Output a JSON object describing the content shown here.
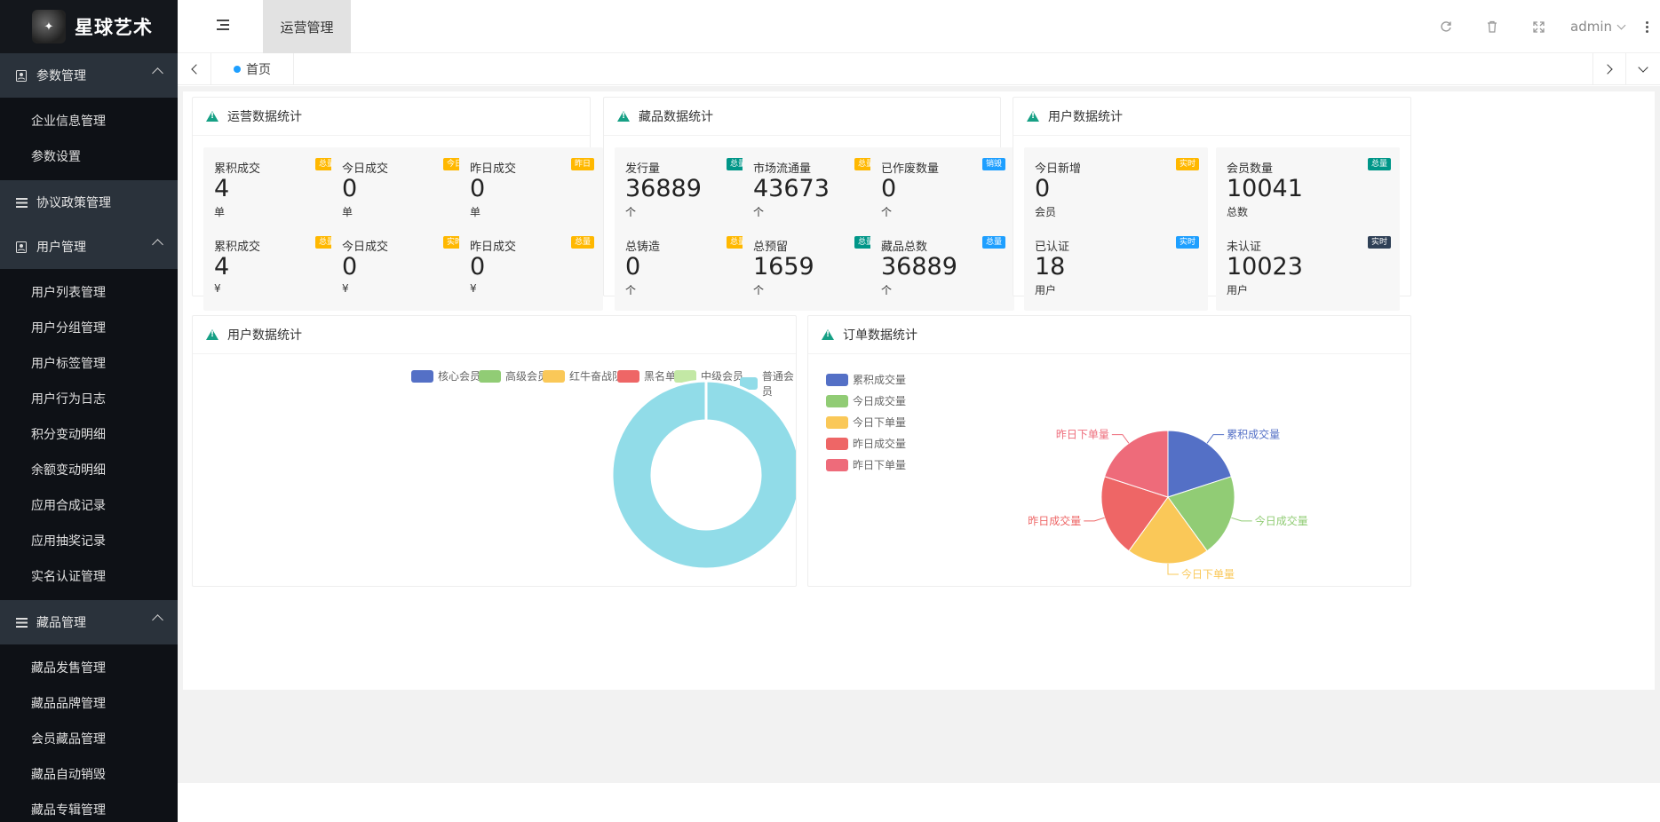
{
  "brand": {
    "name": "星球艺术",
    "logo_text": "✦"
  },
  "sidebar": {
    "groups": [
      {
        "label": "参数管理",
        "icon": "user-card-icon",
        "items": [
          "企业信息管理",
          "参数设置"
        ]
      },
      {
        "label": "协议政策管理",
        "icon": "list-icon",
        "items": []
      },
      {
        "label": "用户管理",
        "icon": "user-card-icon",
        "items": [
          "用户列表管理",
          "用户分组管理",
          "用户标签管理",
          "用户行为日志",
          "积分变动明细",
          "余额变动明细",
          "应用合成记录",
          "应用抽奖记录",
          "实名认证管理"
        ]
      },
      {
        "label": "藏品管理",
        "icon": "list-icon",
        "items": [
          "藏品发售管理",
          "藏品品牌管理",
          "会员藏品管理",
          "藏品自动销毁",
          "藏品专辑管理"
        ]
      }
    ]
  },
  "header": {
    "active_tab": "运营管理",
    "user": "admin"
  },
  "tabs": {
    "home": "首页"
  },
  "ops_stats": {
    "title": "运营数据统计",
    "items": [
      {
        "label": "累积成交",
        "value": "4",
        "unit": "单",
        "badge": "总量",
        "color": "#ffb800"
      },
      {
        "label": "今日成交",
        "value": "0",
        "unit": "单",
        "badge": "今日",
        "color": "#ffb800"
      },
      {
        "label": "昨日成交",
        "value": "0",
        "unit": "单",
        "badge": "昨日",
        "color": "#ffb800"
      },
      {
        "label": "累积成交",
        "value": "4",
        "unit": "¥",
        "badge": "总量",
        "color": "#ffb800"
      },
      {
        "label": "今日成交",
        "value": "0",
        "unit": "¥",
        "badge": "实时",
        "color": "#ffb800"
      },
      {
        "label": "昨日成交",
        "value": "0",
        "unit": "¥",
        "badge": "总量",
        "color": "#ffb800"
      }
    ]
  },
  "collect_stats": {
    "title": "藏品数据统计",
    "items": [
      {
        "label": "发行量",
        "value": "36889",
        "unit": "个",
        "badge": "总量",
        "color": "#009688"
      },
      {
        "label": "市场流通量",
        "value": "43673",
        "unit": "个",
        "badge": "总量",
        "color": "#ffb800"
      },
      {
        "label": "已作废数量",
        "value": "0",
        "unit": "个",
        "badge": "销毁",
        "color": "#1e9fff"
      },
      {
        "label": "总铸造",
        "value": "0",
        "unit": "个",
        "badge": "总量",
        "color": "#ffb800"
      },
      {
        "label": "总预留",
        "value": "1659",
        "unit": "个",
        "badge": "总量",
        "color": "#009688"
      },
      {
        "label": "藏品总数",
        "value": "36889",
        "unit": "个",
        "badge": "总量",
        "color": "#1e9fff"
      }
    ]
  },
  "user_stats": {
    "title": "用户数据统计",
    "items": [
      {
        "label": "今日新增",
        "value": "0",
        "unit": "会员",
        "badge": "实时",
        "color": "#ffb800"
      },
      {
        "label": "会员数量",
        "value": "10041",
        "unit": "总数",
        "badge": "总量",
        "color": "#009688"
      },
      {
        "label": "已认证",
        "value": "18",
        "unit": "用户",
        "badge": "实时",
        "color": "#1e9fff"
      },
      {
        "label": "未认证",
        "value": "10023",
        "unit": "用户",
        "badge": "实时",
        "color": "#2f4056"
      }
    ]
  },
  "chart_data": [
    {
      "type": "pie",
      "title": "用户数据统计",
      "categories": [
        "核心会员",
        "高级会员",
        "红牛奋战队",
        "黑名单",
        "中级会员",
        "普通会员"
      ],
      "values": [
        0,
        0,
        0,
        0,
        0,
        1
      ],
      "colors": [
        "#5470c6",
        "#91cc75",
        "#fac858",
        "#ee6666",
        "#c3e8a5",
        "#91dce8"
      ],
      "donut": true,
      "legend": "top-center"
    },
    {
      "type": "pie",
      "title": "订单数据统计",
      "categories": [
        "累积成交量",
        "今日成交量",
        "今日下单量",
        "昨日成交量",
        "昨日下单量"
      ],
      "values": [
        1,
        1,
        1,
        1,
        1
      ],
      "colors": [
        "#5470c6",
        "#91cc75",
        "#fac858",
        "#ee6666",
        "#ee6b7a"
      ],
      "legend": "top-left"
    }
  ]
}
